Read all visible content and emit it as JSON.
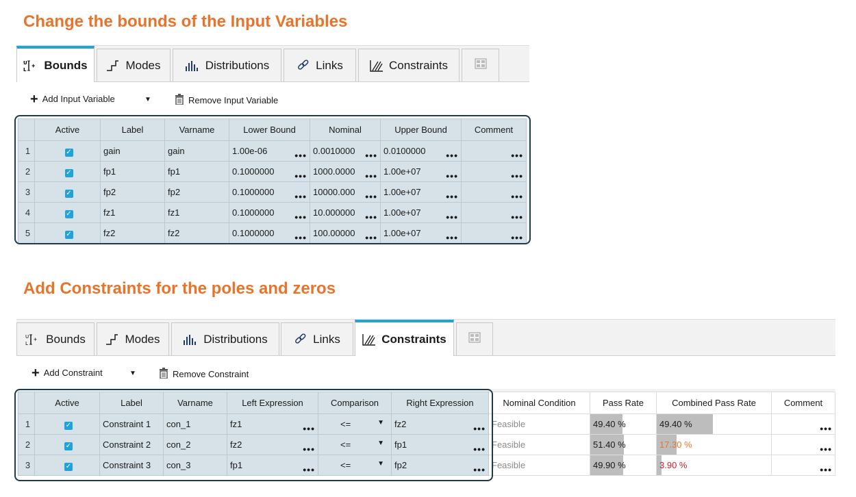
{
  "headings": {
    "first": "Change the bounds of the Input Variables",
    "second": "Add Constraints for the poles and zeros"
  },
  "tabs": [
    "Bounds",
    "Modes",
    "Distributions",
    "Links",
    "Constraints"
  ],
  "panel1": {
    "active_tab": "Bounds",
    "toolbar": {
      "add": "Add Input Variable",
      "remove": "Remove Input Variable"
    },
    "columns": [
      "Active",
      "Label",
      "Varname",
      "Lower Bound",
      "Nominal",
      "Upper Bound",
      "Comment"
    ],
    "rows": [
      {
        "n": "1",
        "label": "gain",
        "varname": "gain",
        "lower": "1.00e-06",
        "nominal": "0.0010000",
        "upper": "0.0100000",
        "comment": ""
      },
      {
        "n": "2",
        "label": "fp1",
        "varname": "fp1",
        "lower": "0.1000000",
        "nominal": "1000.0000",
        "upper": "1.00e+07",
        "comment": ""
      },
      {
        "n": "3",
        "label": "fp2",
        "varname": "fp2",
        "lower": "0.1000000",
        "nominal": "10000.000",
        "upper": "1.00e+07",
        "comment": ""
      },
      {
        "n": "4",
        "label": "fz1",
        "varname": "fz1",
        "lower": "0.1000000",
        "nominal": "10.000000",
        "upper": "1.00e+07",
        "comment": ""
      },
      {
        "n": "5",
        "label": "fz2",
        "varname": "fz2",
        "lower": "0.1000000",
        "nominal": "100.00000",
        "upper": "1.00e+07",
        "comment": ""
      }
    ]
  },
  "panel2": {
    "active_tab": "Constraints",
    "toolbar": {
      "add": "Add Constraint",
      "remove": "Remove Constraint"
    },
    "columns": [
      "Active",
      "Label",
      "Varname",
      "Left Expression",
      "Comparison",
      "Right Expression",
      "Nominal Condition",
      "Pass Rate",
      "Combined Pass Rate",
      "Comment"
    ],
    "rows": [
      {
        "n": "1",
        "label": "Constraint 1",
        "varname": "con_1",
        "left": "fz1",
        "cmp": "<=",
        "right": "fz2",
        "nominal": "Feasible",
        "pass": "49.40 %",
        "pass_frac": 0.494,
        "combined": "49.40 %",
        "combined_frac": 0.494,
        "combined_color": "#1a1a1a"
      },
      {
        "n": "2",
        "label": "Constraint 2",
        "varname": "con_2",
        "left": "fz2",
        "cmp": "<=",
        "right": "fp1",
        "nominal": "Feasible",
        "pass": "51.40 %",
        "pass_frac": 0.514,
        "combined": "17.30 %",
        "combined_frac": 0.173,
        "combined_color": "#e8742c"
      },
      {
        "n": "3",
        "label": "Constraint 3",
        "varname": "con_3",
        "left": "fp1",
        "cmp": "<=",
        "right": "fp2",
        "nominal": "Feasible",
        "pass": "49.90 %",
        "pass_frac": 0.499,
        "combined": "3.90 %",
        "combined_frac": 0.039,
        "combined_color": "#d0202a"
      }
    ]
  },
  "colors": {
    "accent": "#1fa3d8",
    "heading": "#e8742c",
    "selection": "#d6e2e8",
    "bar": "#bdbdbd"
  },
  "icons": [
    "bounds-icon",
    "modes-icon",
    "distributions-icon",
    "links-icon",
    "constraints-icon",
    "grid-icon",
    "plus-icon",
    "trash-icon",
    "chevron-down-icon",
    "checkbox-icon",
    "ellipsis-icon"
  ]
}
